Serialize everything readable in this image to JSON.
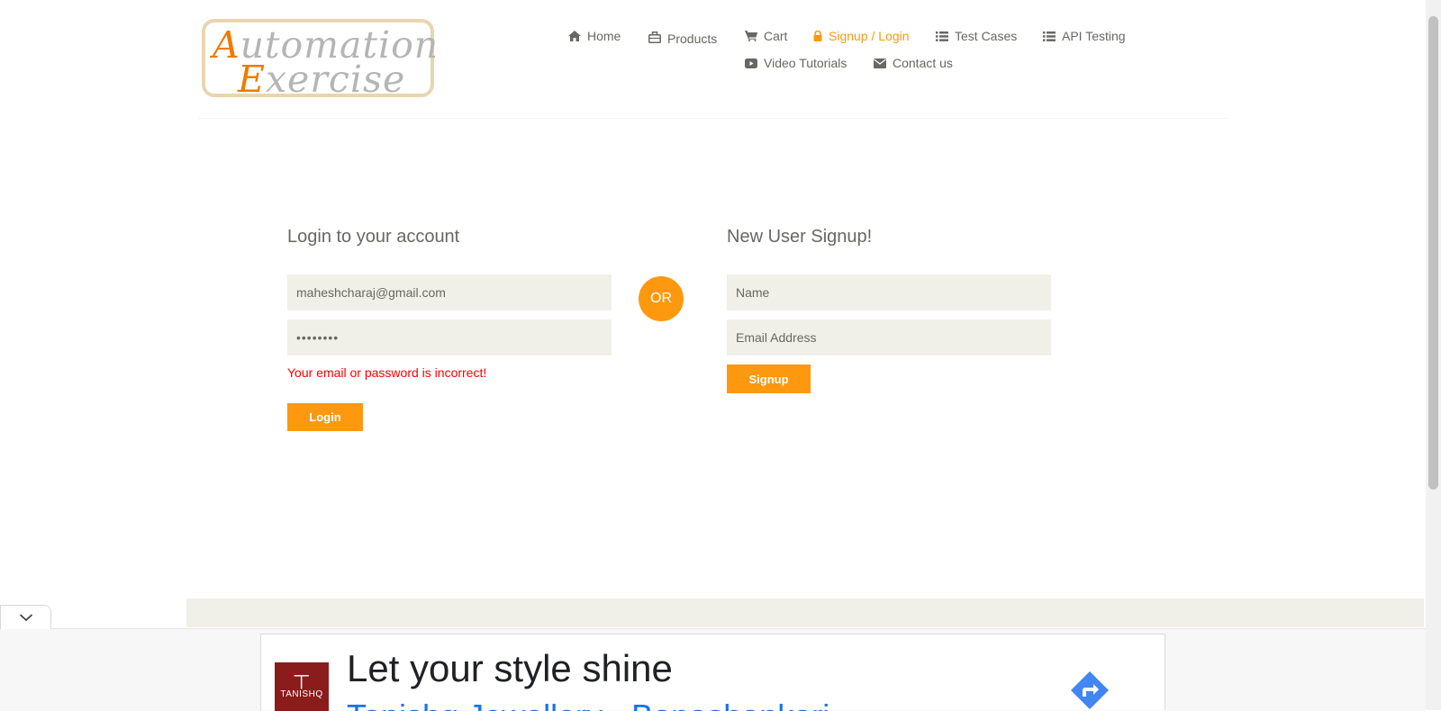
{
  "brand": {
    "line1_cap": "A",
    "line1_rest": "utomation",
    "line2_cap": "E",
    "line2_rest": "xercise",
    "accent": "#fe980f"
  },
  "nav": {
    "items": [
      {
        "label": "Home",
        "icon": "home-icon"
      },
      {
        "label": "Products",
        "icon": "briefcase-icon"
      },
      {
        "label": "Cart",
        "icon": "cart-icon"
      },
      {
        "label": "Signup / Login",
        "icon": "lock-icon",
        "active": true
      },
      {
        "label": "Test Cases",
        "icon": "list-icon"
      },
      {
        "label": "API Testing",
        "icon": "list-icon"
      },
      {
        "label": "Video Tutorials",
        "icon": "youtube-icon"
      },
      {
        "label": "Contact us",
        "icon": "envelope-icon"
      }
    ]
  },
  "login": {
    "title": "Login to your account",
    "email_value": "maheshcharaj@gmail.com",
    "password_value": "password",
    "error": "Your email or password is incorrect!",
    "button": "Login"
  },
  "or_label": "OR",
  "signup": {
    "title": "New User Signup!",
    "name_placeholder": "Name",
    "email_placeholder": "Email Address",
    "button": "Signup"
  },
  "ad": {
    "brand": "TANISHQ",
    "headline": "Let your style shine",
    "subline": "Tanishq Jewellery - Banashankari"
  }
}
